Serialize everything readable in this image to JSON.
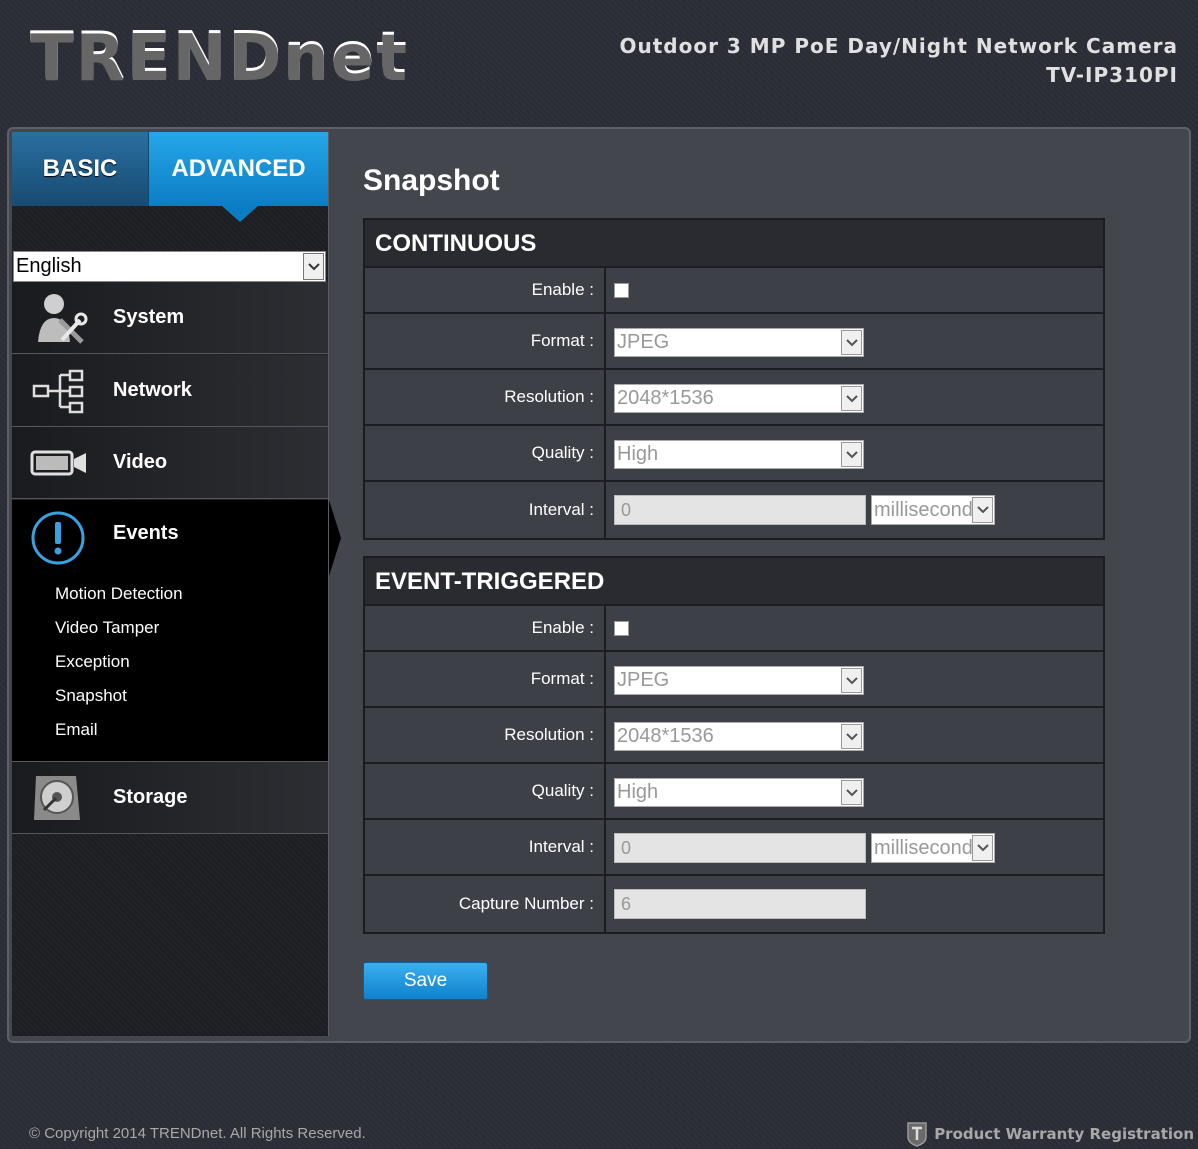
{
  "header": {
    "logo": "TRENDnet",
    "product_line1": "Outdoor 3 MP PoE Day/Night Network Camera",
    "product_line2": "TV-IP310PI"
  },
  "tabs": {
    "basic": "BASIC",
    "advanced": "ADVANCED"
  },
  "language": {
    "selected": "English"
  },
  "menu": {
    "system": "System",
    "network": "Network",
    "video": "Video",
    "events": "Events",
    "storage": "Storage",
    "events_sub": [
      "Motion Detection",
      "Video Tamper",
      "Exception",
      "Snapshot",
      "Email"
    ]
  },
  "page": {
    "title": "Snapshot",
    "continuous": {
      "heading": "CONTINUOUS",
      "enable_label": "Enable :",
      "format_label": "Format :",
      "format_value": "JPEG",
      "resolution_label": "Resolution :",
      "resolution_value": "2048*1536",
      "quality_label": "Quality :",
      "quality_value": "High",
      "interval_label": "Interval :",
      "interval_value": "0",
      "interval_unit": "millisecond"
    },
    "event_triggered": {
      "heading": "EVENT-TRIGGERED",
      "enable_label": "Enable :",
      "format_label": "Format :",
      "format_value": "JPEG",
      "resolution_label": "Resolution :",
      "resolution_value": "2048*1536",
      "quality_label": "Quality :",
      "quality_value": "High",
      "interval_label": "Interval :",
      "interval_value": "0",
      "interval_unit": "millisecond",
      "capture_label": "Capture Number :",
      "capture_value": "6"
    },
    "save_label": "Save"
  },
  "footer": {
    "copyright": "© Copyright 2014 TRENDnet. All Rights Reserved.",
    "warranty": "Product Warranty Registration"
  },
  "colors": {
    "accent": "#0c7dc5",
    "background": "#2b2e36",
    "panel": "#44464e"
  }
}
